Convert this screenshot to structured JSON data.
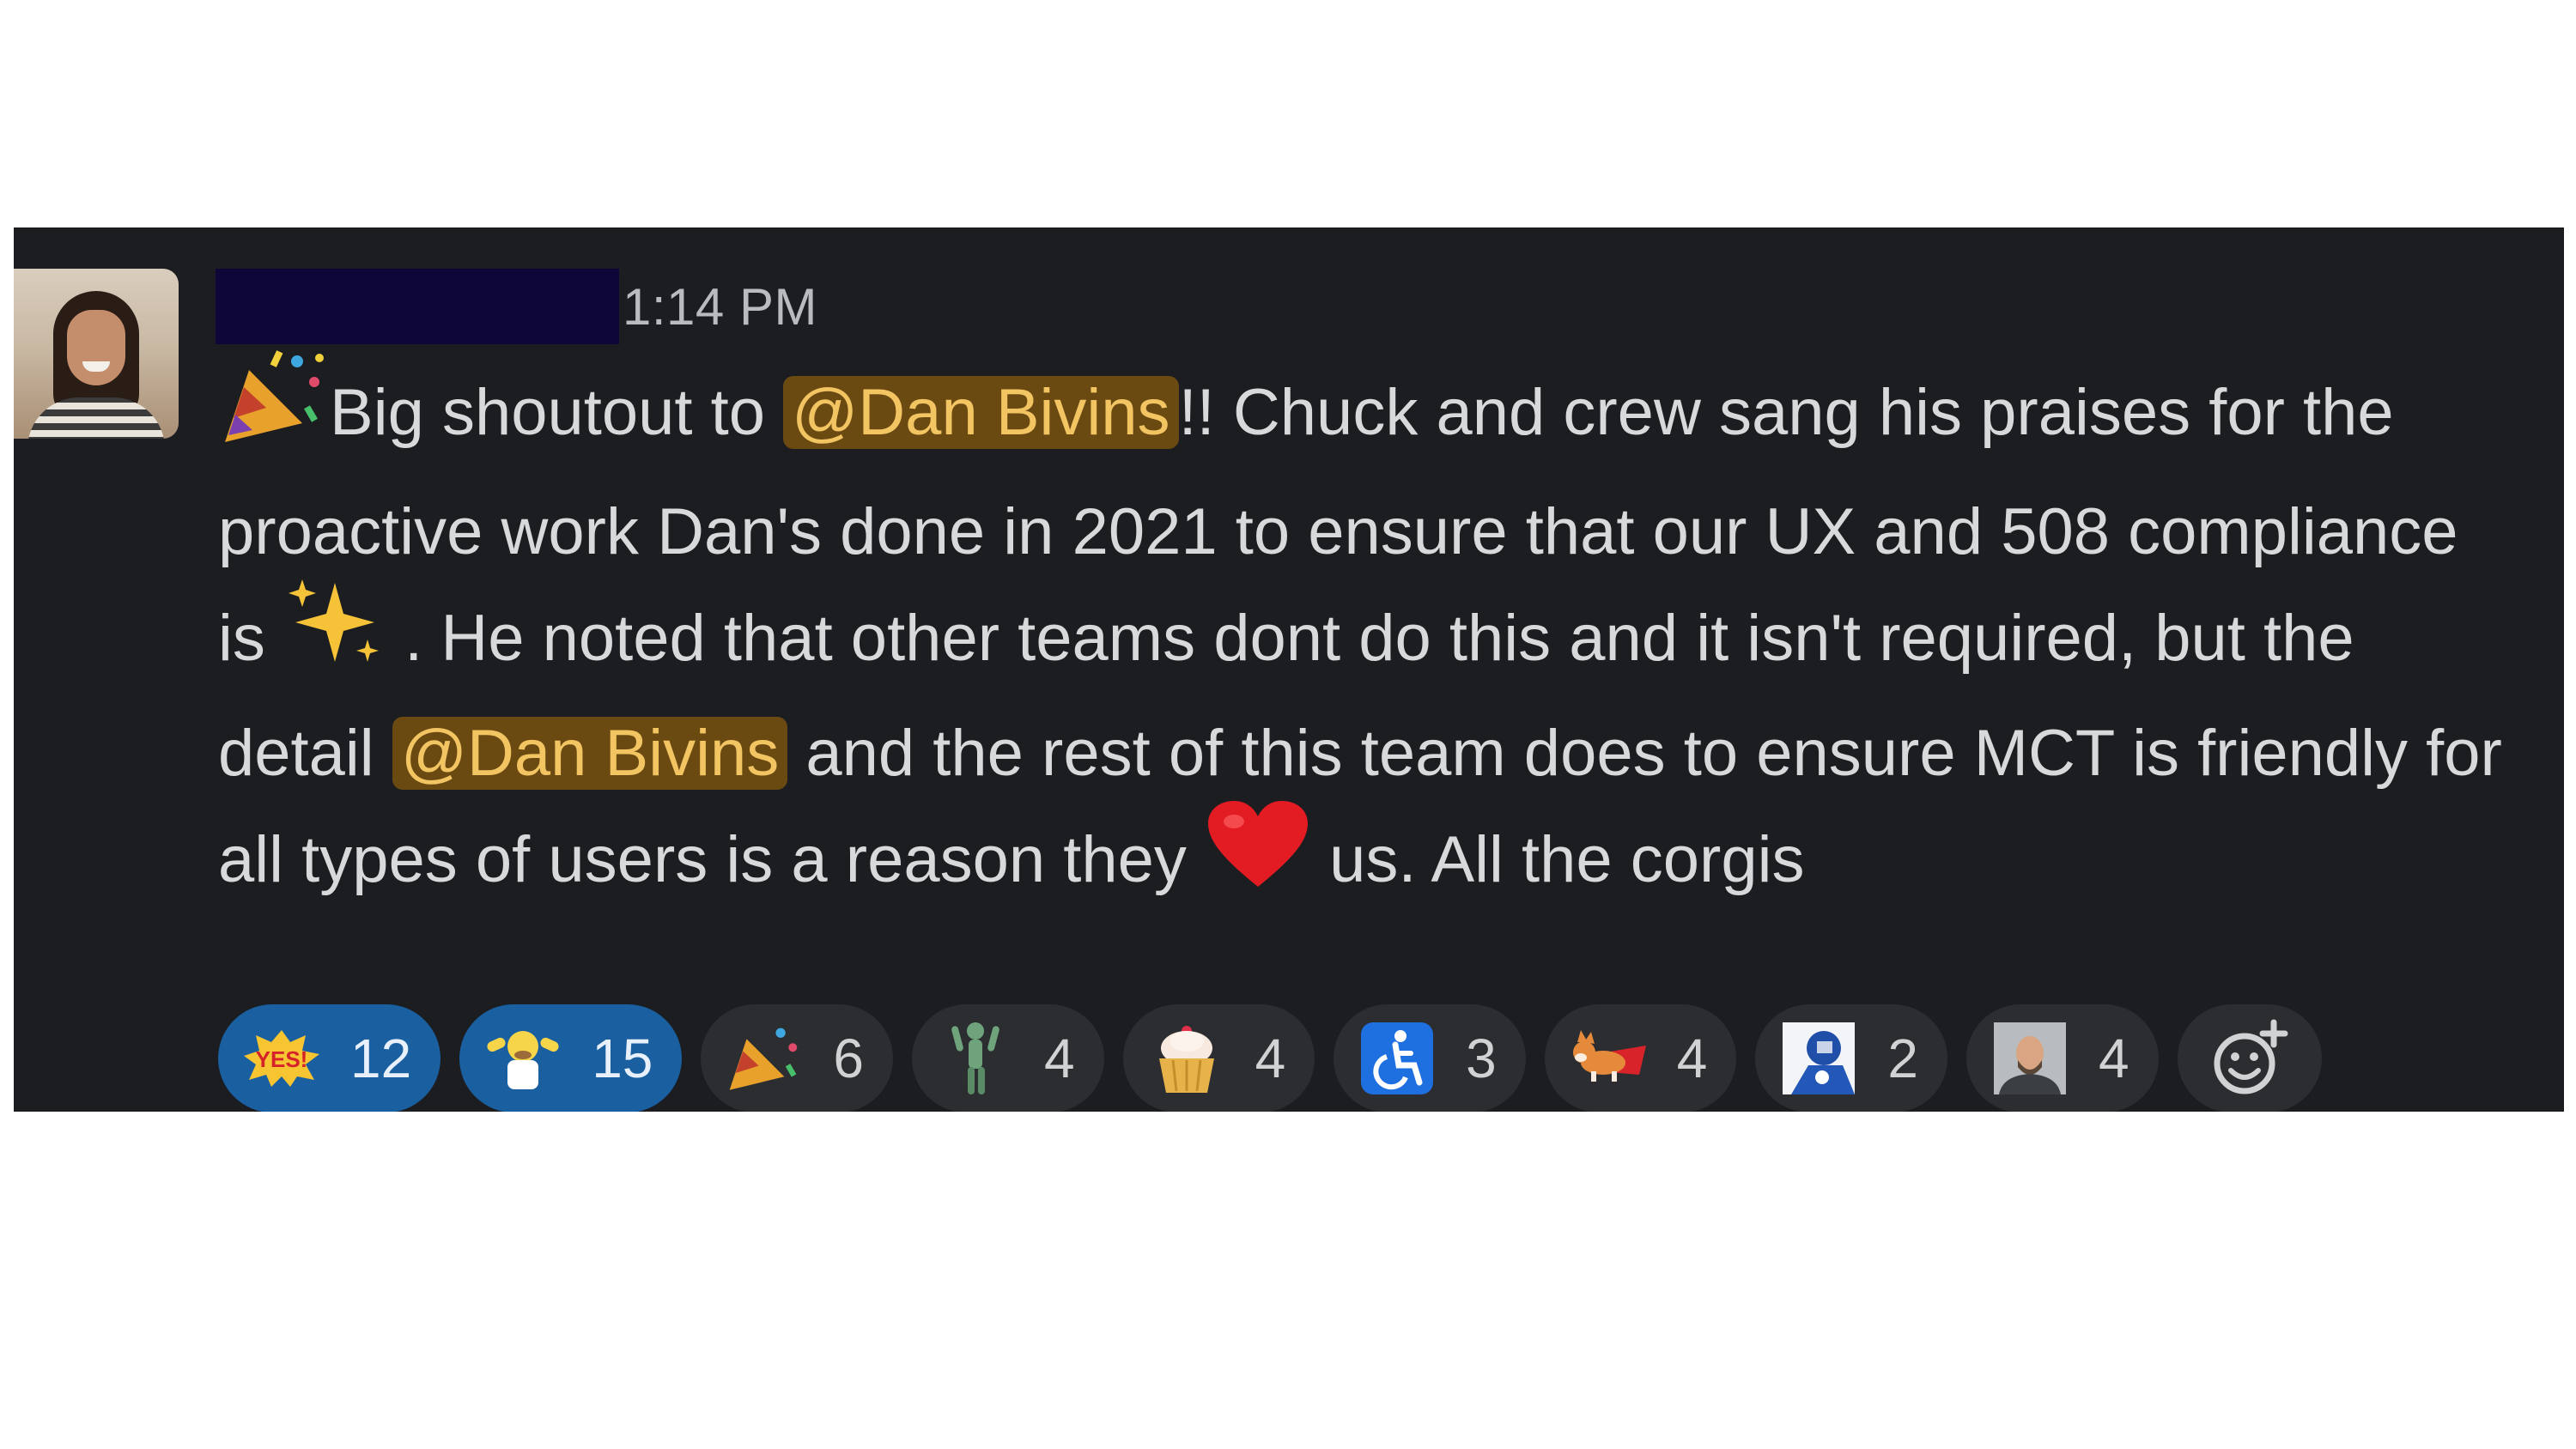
{
  "message": {
    "timestamp": "1:14 PM",
    "body": {
      "p1": "Big shoutout to ",
      "mention1": "@Dan Bivins",
      "p2": "!! Chuck and crew sang his praises for the proactive work Dan's done in 2021 to ensure that our UX and 508 compliance is ",
      "p3": " . He noted that other teams dont do this and it isn't required, but the detail ",
      "mention2": "@Dan Bivins",
      "p4": " and the rest of this team does to ensure MCT is friendly for all types of users is a reason they ",
      "p5": " us. All the corgis"
    },
    "inline_emoji": [
      "party-popper",
      "sparkles",
      "red-heart"
    ]
  },
  "reactions": [
    {
      "icon": "yes-emoji",
      "count": "12",
      "active": true
    },
    {
      "icon": "homer-woohoo-emoji",
      "count": "15",
      "active": true
    },
    {
      "icon": "party-popper-emoji",
      "count": "6",
      "active": false
    },
    {
      "icon": "dancing-figure-emoji",
      "count": "4",
      "active": false
    },
    {
      "icon": "cupcake-emoji",
      "count": "4",
      "active": false
    },
    {
      "icon": "wheelchair-accessibility-emoji",
      "count": "3",
      "active": false
    },
    {
      "icon": "flying-corgi-emoji",
      "count": "4",
      "active": false
    },
    {
      "icon": "hockey-player-emoji",
      "count": "2",
      "active": false
    },
    {
      "icon": "person-photo-emoji",
      "count": "4",
      "active": false
    }
  ],
  "add_reaction": {
    "icon": "add-reaction-icon"
  },
  "colors": {
    "background": "#1b1d21",
    "text": "#d8d9da",
    "timestamp": "#b9bbbe",
    "mention_bg": "#6b4a12",
    "mention_text": "#f2c462",
    "reaction_active": "#1a5fa0",
    "reaction_default": "#2b2d31"
  }
}
